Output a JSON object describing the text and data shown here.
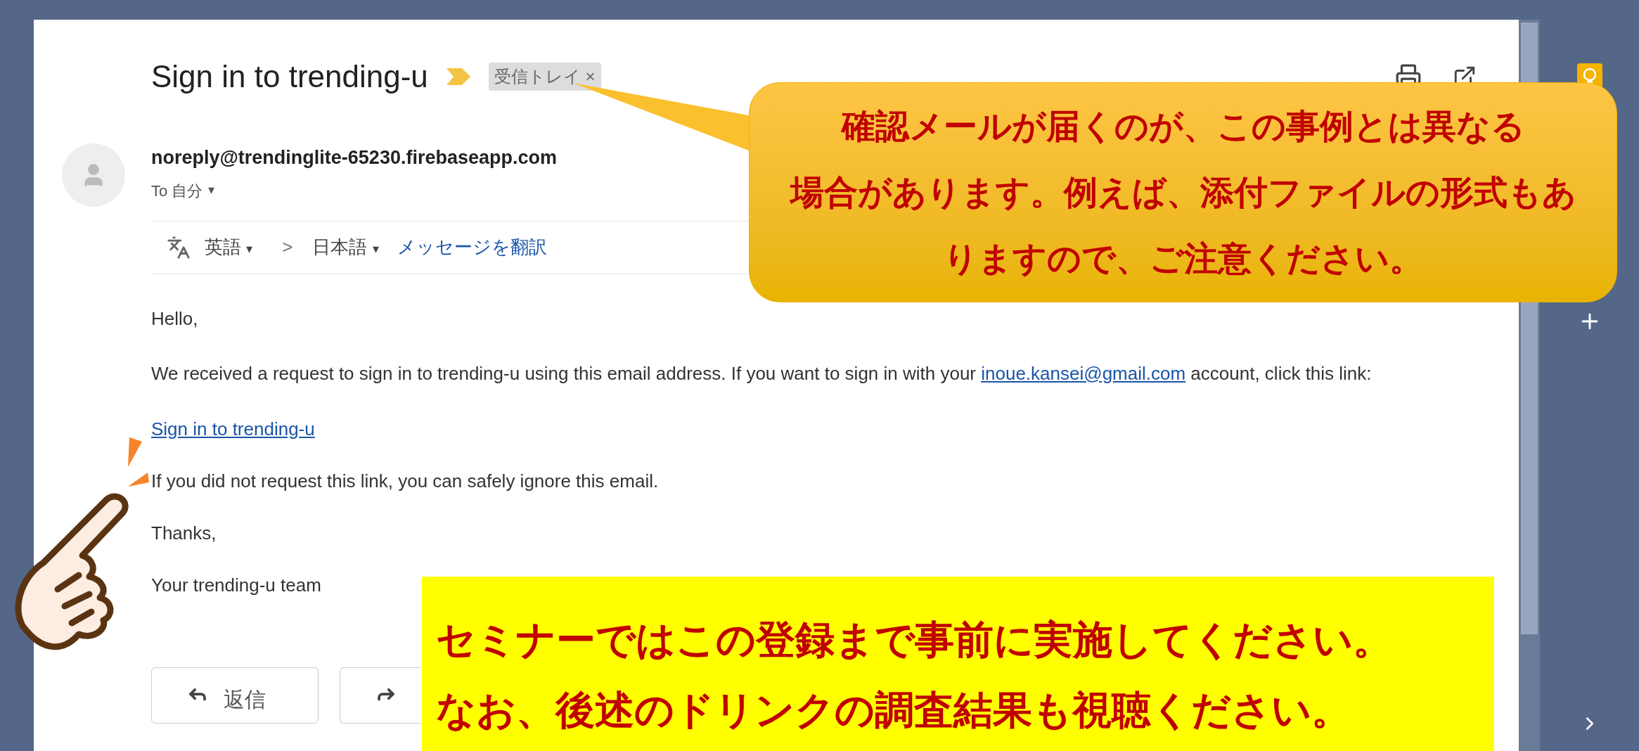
{
  "email": {
    "subject": "Sign in to trending-u",
    "label": {
      "text": "受信トレイ",
      "close": "×"
    },
    "sender": "noreply@trendinglite-65230.firebaseapp.com",
    "recipient": {
      "prefix": "To",
      "name": "自分",
      "caret": "▾"
    },
    "translate": {
      "from": "英語",
      "from_caret": "▾",
      "arrow": ">",
      "to": "日本語",
      "to_caret": "▾",
      "action": "メッセージを翻訳"
    },
    "body": [
      {
        "kind": "text",
        "text": "Hello,"
      },
      {
        "kind": "mixed",
        "before": "We received a request to sign in to trending-u using this email address. If you want to sign in with your ",
        "link": "inoue.kansei@gmail.com",
        "after": " account, click this link:"
      },
      {
        "kind": "link",
        "text": "Sign in to trending-u"
      },
      {
        "kind": "text",
        "text": "If you did not request this link, you can safely ignore this email."
      },
      {
        "kind": "text",
        "text": "Thanks,"
      },
      {
        "kind": "text",
        "text": "Your trending-u team"
      }
    ],
    "buttons": [
      {
        "kind": "reply",
        "label": "返信"
      },
      {
        "kind": "forward"
      }
    ]
  },
  "callout": {
    "lines": [
      "確認メールが届くのが、この事例とは異なる",
      "場合があります。例えば、添付ファイルの形式もあ",
      "りますので、ご注意ください。"
    ]
  },
  "note": {
    "lines": [
      "セミナーではこの登録まで事前に実施してください。",
      "なお、後述のドリンクの調査結果も視聴ください。"
    ]
  }
}
